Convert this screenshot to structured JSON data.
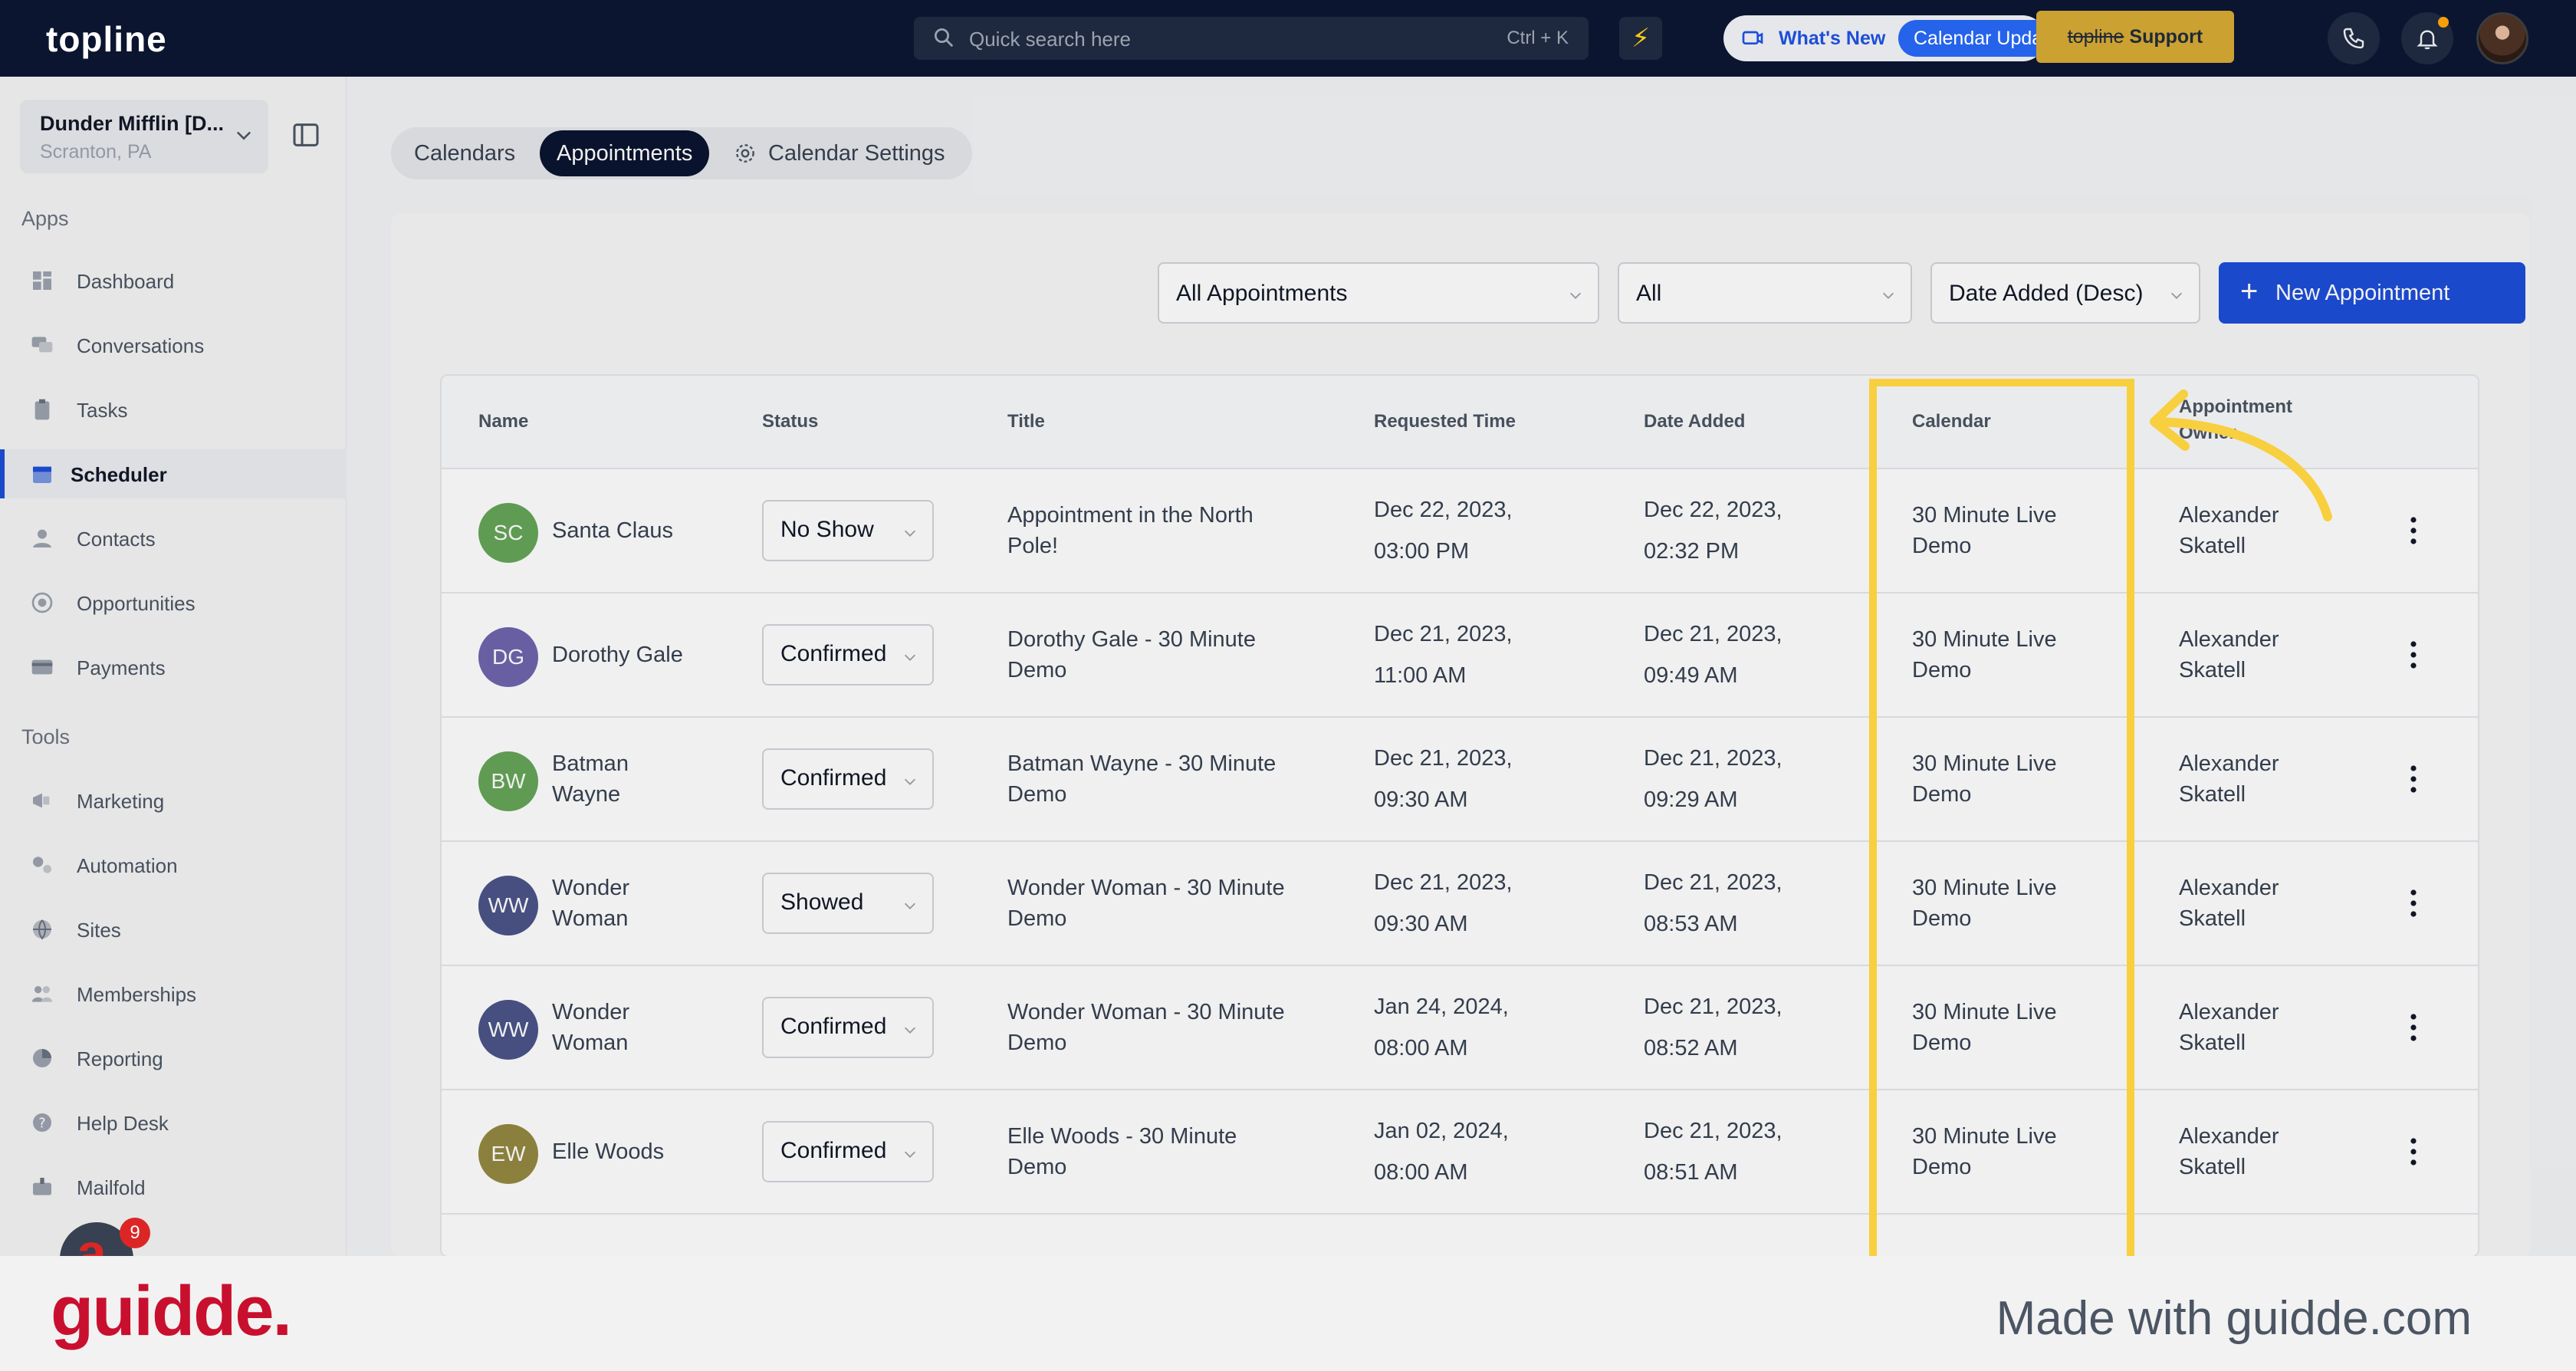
{
  "topbar": {
    "logo": "topline",
    "search_placeholder": "Quick search here",
    "search_shortcut": "Ctrl + K",
    "whats_new": "What's New",
    "calendar_update": "Calendar Upda",
    "support_strike": "topline",
    "support_label": " Support"
  },
  "sidebar": {
    "account_name": "Dunder Mifflin [D...",
    "account_location": "Scranton, PA",
    "apps_label": "Apps",
    "apps": [
      {
        "label": "Dashboard",
        "icon": "dashboard-icon"
      },
      {
        "label": "Conversations",
        "icon": "chat-icon"
      },
      {
        "label": "Tasks",
        "icon": "clipboard-icon"
      },
      {
        "label": "Scheduler",
        "icon": "calendar-icon",
        "active": true
      },
      {
        "label": "Contacts",
        "icon": "person-icon"
      },
      {
        "label": "Opportunities",
        "icon": "target-icon"
      },
      {
        "label": "Payments",
        "icon": "card-icon"
      }
    ],
    "tools_label": "Tools",
    "tools": [
      {
        "label": "Marketing",
        "icon": "megaphone-icon"
      },
      {
        "label": "Automation",
        "icon": "gears-icon"
      },
      {
        "label": "Sites",
        "icon": "globe-icon"
      },
      {
        "label": "Memberships",
        "icon": "people-icon"
      },
      {
        "label": "Reporting",
        "icon": "pie-icon"
      },
      {
        "label": "Help Desk",
        "icon": "help-icon"
      },
      {
        "label": "Mailfold",
        "icon": "mailbox-icon"
      }
    ],
    "notification_count": "9"
  },
  "tabs": [
    {
      "label": "Calendars"
    },
    {
      "label": "Appointments",
      "active": true
    },
    {
      "label": "Calendar Settings"
    }
  ],
  "filters": {
    "appointment_type": "All Appointments",
    "status": "All",
    "sort": "Date Added (Desc)",
    "new_button": "New Appointment"
  },
  "table": {
    "headers": [
      "Name",
      "Status",
      "Title",
      "Requested Time",
      "Date Added",
      "Calendar",
      "Appointment Owner"
    ],
    "rows": [
      {
        "initials": "SC",
        "avatar_color": "#3f8f2f",
        "name": [
          "Santa Claus"
        ],
        "status": "No Show",
        "title": [
          "Appointment in the North",
          "Pole!"
        ],
        "requested": [
          "Dec 22, 2023,",
          "03:00 PM"
        ],
        "added": [
          "Dec 22, 2023,",
          "02:32 PM"
        ],
        "calendar": [
          "30 Minute Live",
          "Demo"
        ],
        "owner": [
          "Alexander",
          "Skatell"
        ]
      },
      {
        "initials": "DG",
        "avatar_color": "#4c3f99",
        "name": [
          "Dorothy Gale"
        ],
        "status": "Confirmed",
        "title": [
          "Dorothy Gale - 30 Minute",
          "Demo"
        ],
        "requested": [
          "Dec 21, 2023,",
          "11:00 AM"
        ],
        "added": [
          "Dec 21, 2023,",
          "09:49 AM"
        ],
        "calendar": [
          "30 Minute Live",
          "Demo"
        ],
        "owner": [
          "Alexander",
          "Skatell"
        ]
      },
      {
        "initials": "BW",
        "avatar_color": "#3f8f2f",
        "name": [
          "Batman",
          "Wayne"
        ],
        "status": "Confirmed",
        "title": [
          "Batman Wayne - 30 Minute",
          "Demo"
        ],
        "requested": [
          "Dec 21, 2023,",
          "09:30 AM"
        ],
        "added": [
          "Dec 21, 2023,",
          "09:29 AM"
        ],
        "calendar": [
          "30 Minute Live",
          "Demo"
        ],
        "owner": [
          "Alexander",
          "Skatell"
        ]
      },
      {
        "initials": "WW",
        "avatar_color": "#1f2a6b",
        "name": [
          "Wonder",
          "Woman"
        ],
        "status": "Showed",
        "title": [
          "Wonder Woman - 30 Minute",
          "Demo"
        ],
        "requested": [
          "Dec 21, 2023,",
          "09:30 AM"
        ],
        "added": [
          "Dec 21, 2023,",
          "08:53 AM"
        ],
        "calendar": [
          "30 Minute Live",
          "Demo"
        ],
        "owner": [
          "Alexander",
          "Skatell"
        ]
      },
      {
        "initials": "WW",
        "avatar_color": "#1f2a6b",
        "name": [
          "Wonder",
          "Woman"
        ],
        "status": "Confirmed",
        "title": [
          "Wonder Woman - 30 Minute",
          "Demo"
        ],
        "requested": [
          "Jan 24, 2024,",
          "08:00 AM"
        ],
        "added": [
          "Dec 21, 2023,",
          "08:52 AM"
        ],
        "calendar": [
          "30 Minute Live",
          "Demo"
        ],
        "owner": [
          "Alexander",
          "Skatell"
        ]
      },
      {
        "initials": "EW",
        "avatar_color": "#7a6a12",
        "name": [
          "Elle Woods"
        ],
        "status": "Confirmed",
        "title": [
          "Elle Woods - 30 Minute",
          "Demo"
        ],
        "requested": [
          "Jan 02, 2024,",
          "08:00 AM"
        ],
        "added": [
          "Dec 21, 2023,",
          "08:51 AM"
        ],
        "calendar": [
          "30 Minute Live",
          "Demo"
        ],
        "owner": [
          "Alexander",
          "Skatell"
        ]
      }
    ]
  },
  "colors": {
    "highlight": "#f8cf3e",
    "primary": "#1d4ed8",
    "topbar": "#0b1530"
  },
  "footer": {
    "brand": "guidde.",
    "made_with": "Made with guidde.com"
  }
}
